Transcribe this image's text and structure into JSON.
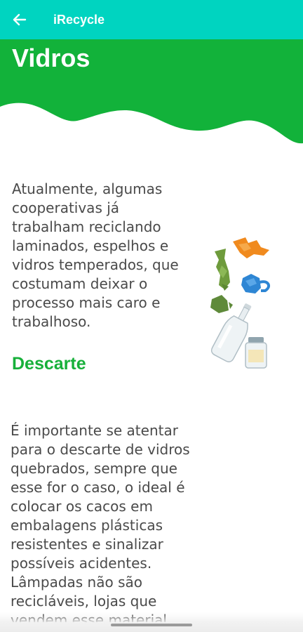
{
  "appbar": {
    "title": "iRecycle",
    "back_icon": "arrow-left-icon",
    "color": "#00d4c0"
  },
  "hero": {
    "title": "Vidros",
    "color": "#12b23a"
  },
  "intro_text": "Atualmente, algumas cooperativas já trabalham reciclando laminados, espelhos e vidros temperados, que costumam deixar o processo mais caro e trabalhoso.",
  "illustration": {
    "icon": "broken-glass-bottles-illustration"
  },
  "section": {
    "title": "Descarte",
    "color": "#17b03a"
  },
  "discard_text": "É importante se atentar para o descarte de vidros quebrados, sempre que esse for o caso, o ideal é colocar os cacos em embalagens plásticas resistentes e sinalizar possíveis acidentes. Lâmpadas não são recicláveis, lojas que vendem esse material"
}
